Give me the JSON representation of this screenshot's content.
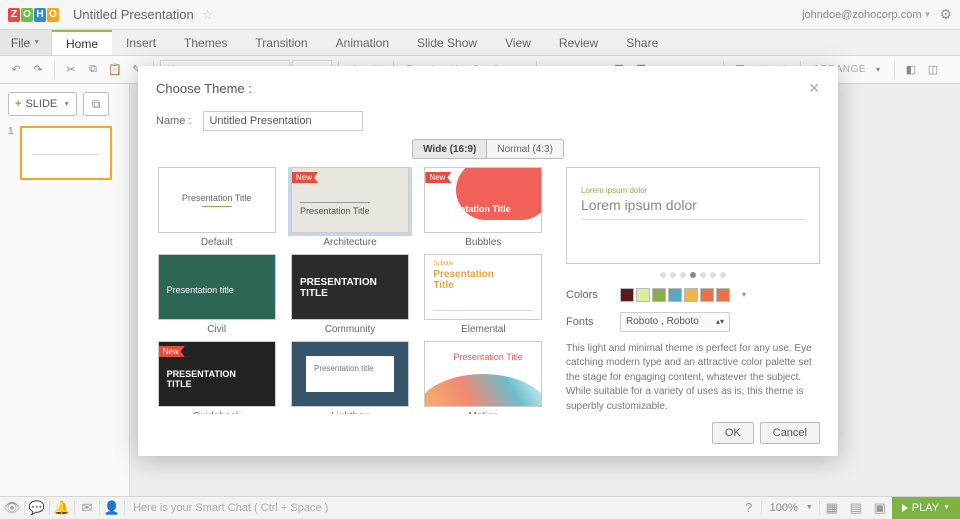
{
  "titlebar": {
    "doc_title": "Untitled Presentation",
    "user": "johndoe@zohocorp.com",
    "logo": [
      "Z",
      "O",
      "H",
      "O"
    ]
  },
  "menu": {
    "file": "File",
    "items": [
      "Home",
      "Insert",
      "Themes",
      "Transition",
      "Animation",
      "Slide Show",
      "View",
      "Review",
      "Share"
    ],
    "active": 0
  },
  "toolbar": {
    "font": "Alegreya",
    "arrange": "ARRANGE"
  },
  "sidepanel": {
    "add_slide": "SLIDE",
    "slide_num": "1"
  },
  "statusbar": {
    "chat_hint": "Here is your Smart Chat ( Ctrl + Space )",
    "zoom": "100%",
    "play": "PLAY"
  },
  "dialog": {
    "title": "Choose Theme :",
    "name_label": "Name :",
    "name_value": "Untitled Presentation",
    "aspect": {
      "wide": "Wide (16:9)",
      "normal": "Normal (4:3)"
    },
    "themes": [
      {
        "label": "Default"
      },
      {
        "label": "Architecture",
        "new": true,
        "selected": true
      },
      {
        "label": "Bubbles",
        "new": true
      },
      {
        "label": "Civil"
      },
      {
        "label": "Community"
      },
      {
        "label": "Elemental"
      },
      {
        "label": "Guidebook",
        "new": true
      },
      {
        "label": "Lightbox"
      },
      {
        "label": "Motion"
      }
    ],
    "preview": {
      "sub": "Lorem ipsum dolor",
      "title": "Lorem ipsum dolor"
    },
    "colors_label": "Colors",
    "fonts_label": "Fonts",
    "font_value": "Roboto , Roboto",
    "swatches": [
      "#5a1a1a",
      "#d9ef9f",
      "#8bad4a",
      "#5aa8c9",
      "#f0b44a",
      "#e8734a",
      "#e8734a"
    ],
    "description": "This light and minimal theme is perfect for any use. Eye catching modern type and an attractive color palette set the stage for engaging content, whatever the subject. While suitable for a variety of uses as is, this theme is superbly customizable.",
    "ok": "OK",
    "cancel": "Cancel",
    "new_badge": "New"
  }
}
